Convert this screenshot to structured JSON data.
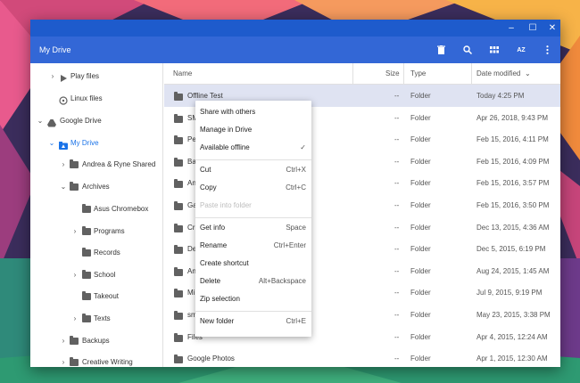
{
  "window": {
    "title": "My Drive"
  },
  "toolbar": {
    "title": "My Drive",
    "icons": [
      "trash-icon",
      "search-icon",
      "grid-view-icon",
      "sort-az-icon",
      "more-vert-icon"
    ],
    "az_label": "AZ"
  },
  "sidebar": {
    "items": [
      {
        "label": "Play files"
      },
      {
        "label": "Linux files"
      },
      {
        "label": "Google Drive"
      },
      {
        "label": "My Drive"
      },
      {
        "label": "Andrea & Ryne Shared"
      },
      {
        "label": "Archives"
      },
      {
        "label": "Asus Chromebox"
      },
      {
        "label": "Programs"
      },
      {
        "label": "Records"
      },
      {
        "label": "School"
      },
      {
        "label": "Takeout"
      },
      {
        "label": "Texts"
      },
      {
        "label": "Backups"
      },
      {
        "label": "Creative Writing"
      }
    ]
  },
  "table": {
    "headers": {
      "name": "Name",
      "size": "Size",
      "type": "Type",
      "date": "Date modified",
      "sort_arrow": "⌄"
    },
    "rows": [
      {
        "name": "Offline Test",
        "size": "--",
        "type": "Folder",
        "date": "Today 4:25 PM"
      },
      {
        "name": "SM",
        "size": "--",
        "type": "Folder",
        "date": "Apr 26, 2018, 9:43 PM"
      },
      {
        "name": "Pe",
        "size": "--",
        "type": "Folder",
        "date": "Feb 15, 2016, 4:11 PM"
      },
      {
        "name": "Ba",
        "size": "--",
        "type": "Folder",
        "date": "Feb 15, 2016, 4:09 PM"
      },
      {
        "name": "An",
        "size": "--",
        "type": "Folder",
        "date": "Feb 15, 2016, 3:57 PM"
      },
      {
        "name": "Ga",
        "size": "--",
        "type": "Folder",
        "date": "Feb 15, 2016, 3:50 PM"
      },
      {
        "name": "Cr",
        "size": "--",
        "type": "Folder",
        "date": "Dec 13, 2015, 4:36 AM"
      },
      {
        "name": "De",
        "size": "--",
        "type": "Folder",
        "date": "Dec 5, 2015, 6:19 PM"
      },
      {
        "name": "An",
        "size": "--",
        "type": "Folder",
        "date": "Aug 24, 2015, 1:45 AM"
      },
      {
        "name": "Mi",
        "size": "--",
        "type": "Folder",
        "date": "Jul 9, 2015, 9:19 PM"
      },
      {
        "name": "sm",
        "size": "--",
        "type": "Folder",
        "date": "May 23, 2015, 3:38 PM"
      },
      {
        "name": "Files",
        "size": "--",
        "type": "Folder",
        "date": "Apr 4, 2015, 12:24 AM"
      },
      {
        "name": "Google Photos",
        "size": "--",
        "type": "Folder",
        "date": "Apr 1, 2015, 12:30 AM"
      }
    ]
  },
  "context_menu": {
    "items": [
      {
        "label": "Share with others",
        "shortcut": ""
      },
      {
        "label": "Manage in Drive",
        "shortcut": ""
      },
      {
        "label": "Available offline",
        "shortcut": "✓"
      },
      {
        "label": "Cut",
        "shortcut": "Ctrl+X"
      },
      {
        "label": "Copy",
        "shortcut": "Ctrl+C"
      },
      {
        "label": "Paste into folder",
        "shortcut": ""
      },
      {
        "label": "Get info",
        "shortcut": "Space"
      },
      {
        "label": "Rename",
        "shortcut": "Ctrl+Enter"
      },
      {
        "label": "Create shortcut",
        "shortcut": ""
      },
      {
        "label": "Delete",
        "shortcut": "Alt+Backspace"
      },
      {
        "label": "Zip selection",
        "shortcut": ""
      },
      {
        "label": "New folder",
        "shortcut": "Ctrl+E"
      }
    ]
  },
  "colors": {
    "titlebar": "#1e5bcc",
    "toolbar": "#3367d6",
    "accent": "#1a73e8",
    "selection": "#dfe3f2"
  }
}
